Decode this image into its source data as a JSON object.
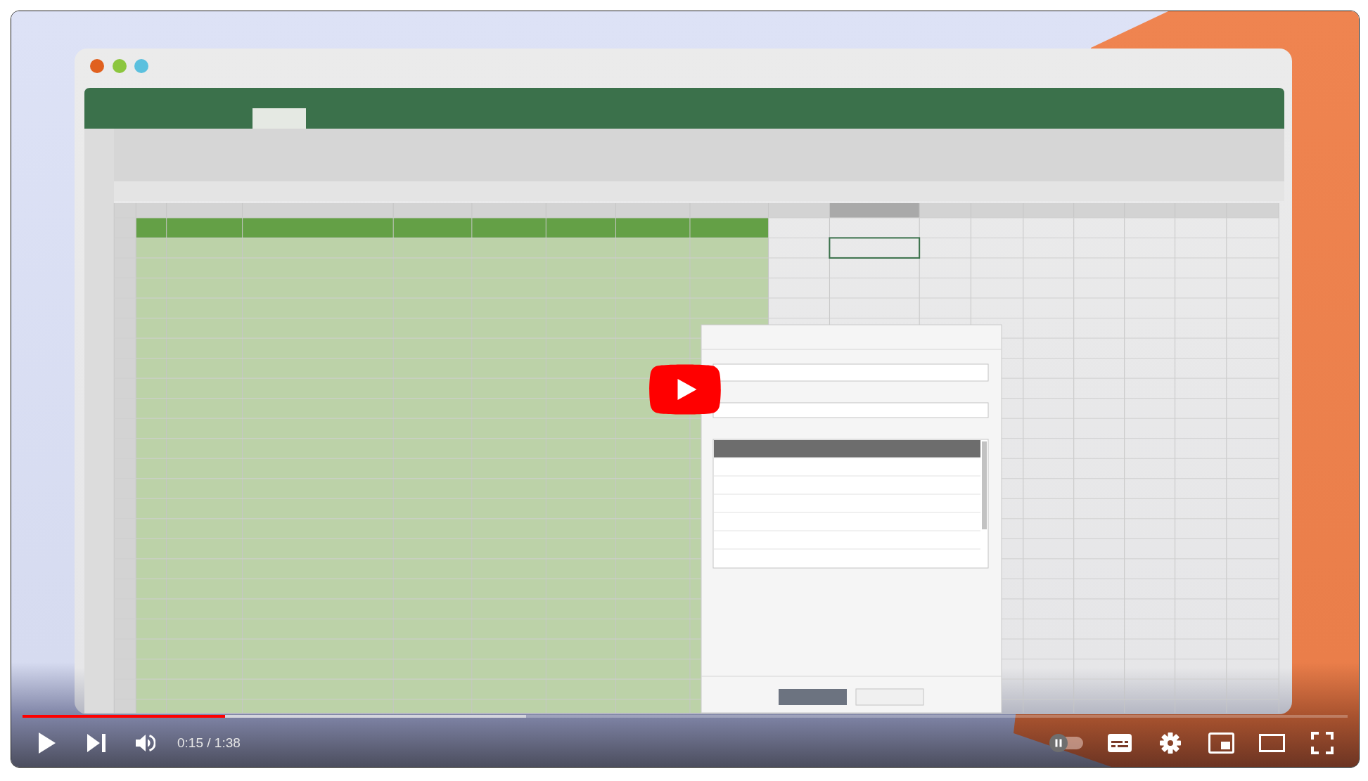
{
  "progress": {
    "level": 0.153,
    "buffer": {
      "level": 0.38
    }
  },
  "controls": {
    "playing": false,
    "muted": false,
    "time": "0:15 / 1:38",
    "autoplay": {
      "on": false
    },
    "captions": {
      "on": false
    }
  }
}
